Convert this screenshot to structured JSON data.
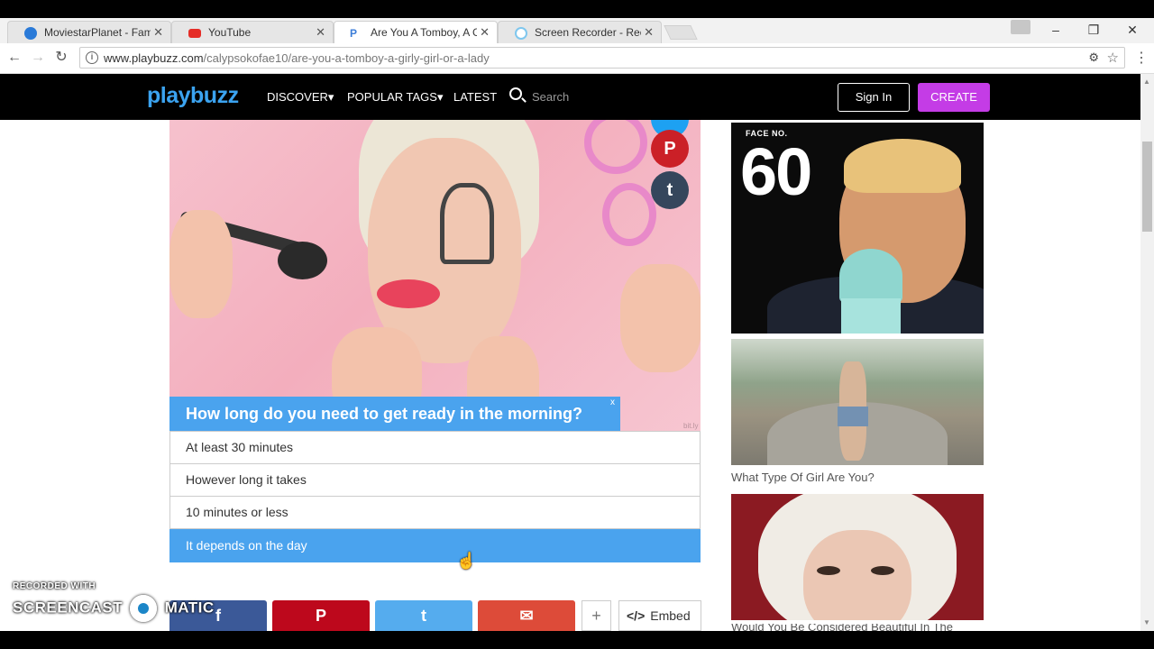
{
  "browser": {
    "tabs": [
      {
        "label": "MoviestarPlanet - Fame",
        "icon": "ie-icon",
        "active": false
      },
      {
        "label": "YouTube",
        "icon": "youtube-icon",
        "active": false
      },
      {
        "label": "Are You A Tomboy, A Gir",
        "icon": "playbuzz-icon",
        "active": true
      },
      {
        "label": "Screen Recorder - Recor",
        "icon": "screencast-icon",
        "active": false
      }
    ],
    "url_domain": "www.playbuzz.com",
    "url_path": "/calypsokofae10/are-you-a-tomboy-a-girly-girl-or-a-lady"
  },
  "site": {
    "logo": "playbuzz",
    "nav": {
      "discover": "DISCOVER▾",
      "popular_tags": "POPULAR TAGS▾",
      "latest": "LATEST"
    },
    "search_placeholder": "Search",
    "signin": "Sign In",
    "create": "CREATE"
  },
  "quiz": {
    "question": "How long do you need to get ready in the morning?",
    "close_mark": "x",
    "image_credit": "bit.ly",
    "answers": [
      "At least 30 minutes",
      "However long it takes",
      "10 minutes or less",
      "It depends on the day"
    ],
    "selected_answer_index": 3
  },
  "share": {
    "facebook": "f",
    "pinterest": "P",
    "twitter": "t",
    "email": "✉",
    "plus": "+",
    "embed": "Embed",
    "embed_code": "</>"
  },
  "image_share_icons": {
    "pinterest": "P",
    "tumblr": "t"
  },
  "sidebar": {
    "items": [
      {
        "overlay_label": "FACE NO.",
        "overlay_number": "60",
        "caption": ""
      },
      {
        "caption": "What Type Of Girl Are You?"
      },
      {
        "caption": "Would You Be Considered Beautiful In The"
      }
    ]
  },
  "watermark": {
    "line1": "RECORDED WITH",
    "brand_left": "SCREENCAST",
    "brand_right": "MATIC"
  },
  "colors": {
    "accent_blue": "#4aa3ee",
    "create_purple": "#c43ce6",
    "facebook": "#3b5998",
    "pinterest": "#bd081c",
    "twitter": "#55acee",
    "email": "#dd4b39"
  }
}
